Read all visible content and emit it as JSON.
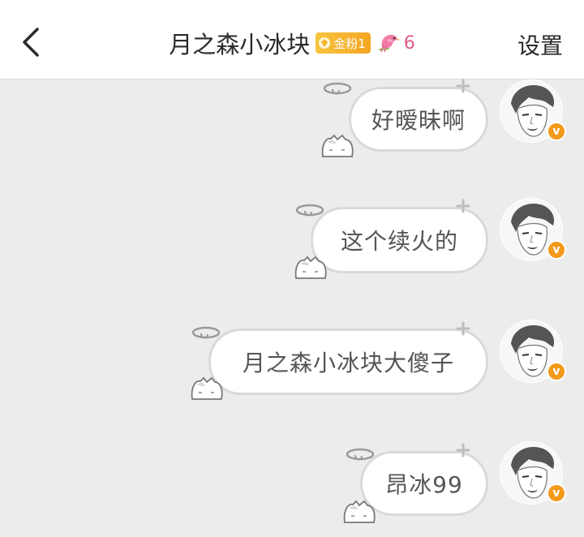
{
  "header": {
    "title": "月之森小冰块",
    "fan_badge": "金粉1",
    "fan_level": "6",
    "settings_label": "设置"
  },
  "colors": {
    "header_bg": "#ffffff",
    "chat_bg": "#ececec",
    "badge_gold": "#f5a623",
    "level_pink": "#e05a8c",
    "verified_orange": "#f39a1b"
  },
  "messages": [
    {
      "text": "好暧昧啊",
      "verified_label": "v"
    },
    {
      "text": "这个续火的",
      "verified_label": "v"
    },
    {
      "text": "月之森小冰块大傻子",
      "verified_label": "v"
    },
    {
      "text": "昂冰99",
      "verified_label": "v"
    }
  ]
}
